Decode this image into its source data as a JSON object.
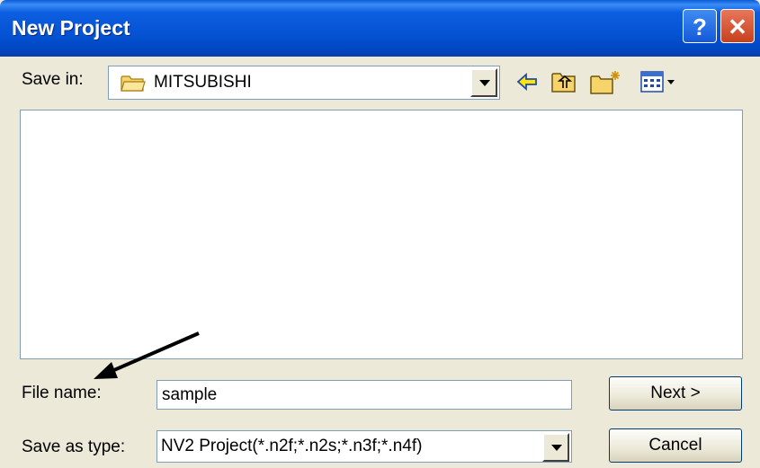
{
  "window": {
    "title": "New Project",
    "help_symbol": "?",
    "close_symbol": "✕"
  },
  "save_in": {
    "label": "Save in:",
    "value": "MITSUBISHI",
    "icon": "folder-icon"
  },
  "toolbar": {
    "icons": [
      "back-arrow-icon",
      "up-folder-icon",
      "new-folder-icon",
      "view-menu-icon"
    ]
  },
  "file_list": {
    "items": []
  },
  "file_name": {
    "label": "File name:",
    "value": "sample"
  },
  "save_as_type": {
    "label": "Save as type:",
    "value": "NV2 Project(*.n2f;*.n2s;*.n3f;*.n4f)"
  },
  "buttons": {
    "next": "Next >",
    "cancel": "Cancel"
  },
  "colors": {
    "titlebar": "#0553d4",
    "dialog_bg": "#ece9d8",
    "close_button": "#c7401d"
  }
}
